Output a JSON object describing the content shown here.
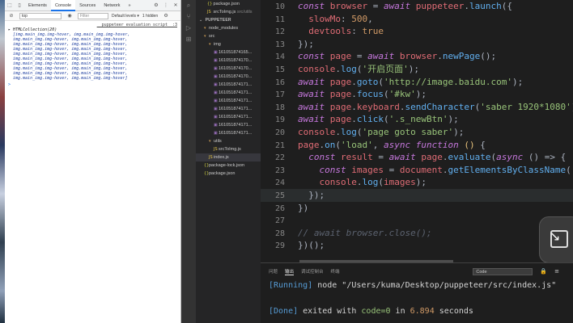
{
  "devtools": {
    "tabs": [
      "Elements",
      "Console",
      "Sources",
      "Network",
      "»"
    ],
    "active_tab": "Console",
    "context": "top",
    "filter_placeholder": "Filter",
    "levels": "Default levels ▾",
    "hidden_count": "1 hidden",
    "source_link": "__puppeteer_evaluation_script__:3",
    "collection_label": "HTMLCollection(20)",
    "collection_items": [
      "[img.main_img.img-hover, img.main_img.img-hover,",
      "img.main_img.img-hover, img.main_img.img-hover,",
      "img.main_img.img-hover, img.main_img.img-hover,",
      "img.main_img.img-hover, img.main_img.img-hover,",
      "img.main_img.img-hover, img.main_img.img-hover,",
      "img.main_img.img-hover, img.main_img.img-hover,",
      "img.main_img.img-hover, img.main_img.img-hover,",
      "img.main_img.img-hover, img.main_img.img-hover,",
      "img.main_img.img-hover, img.main_img.img-hover,",
      "img.main_img.img-hover, img.main_img.img-hover]"
    ],
    "prompt": ">"
  },
  "explorer": {
    "top_items": [
      {
        "name": "package.json",
        "icon": "json"
      },
      {
        "name": "srcToImg.js",
        "icon": "js",
        "suffix": "src/utils"
      }
    ],
    "section_title": "PUPPETEER",
    "tree": [
      {
        "name": "node_modules",
        "type": "folder",
        "depth": 1
      },
      {
        "name": "src",
        "type": "folder",
        "depth": 1
      },
      {
        "name": "img",
        "type": "folder",
        "depth": 2
      },
      {
        "name": "161051874165...",
        "type": "image",
        "depth": 3
      },
      {
        "name": "161051874170...",
        "type": "image",
        "depth": 3
      },
      {
        "name": "161051874170...",
        "type": "image",
        "depth": 3
      },
      {
        "name": "161051874170...",
        "type": "image",
        "depth": 3
      },
      {
        "name": "161051874171...",
        "type": "image",
        "depth": 3
      },
      {
        "name": "161051874171...",
        "type": "image",
        "depth": 3
      },
      {
        "name": "161051874171...",
        "type": "image",
        "depth": 3
      },
      {
        "name": "161051874171...",
        "type": "image",
        "depth": 3
      },
      {
        "name": "161051874171...",
        "type": "image",
        "depth": 3
      },
      {
        "name": "161051874171...",
        "type": "image",
        "depth": 3
      },
      {
        "name": "161051874171...",
        "type": "image",
        "depth": 3
      },
      {
        "name": "utils",
        "type": "folder",
        "depth": 2
      },
      {
        "name": "srcToImg.js",
        "type": "js",
        "depth": 3
      },
      {
        "name": "index.js",
        "type": "js",
        "depth": 2,
        "selected": true
      },
      {
        "name": "package-lock.json",
        "type": "json",
        "depth": 1
      },
      {
        "name": "package.json",
        "type": "json",
        "depth": 1
      }
    ]
  },
  "editor": {
    "lines": [
      {
        "n": "10",
        "tokens": [
          [
            "kw",
            "const "
          ],
          [
            "var",
            "browser"
          ],
          [
            "pun",
            " = "
          ],
          [
            "kw",
            "await "
          ],
          [
            "var",
            "puppeteer"
          ],
          [
            "pun",
            "."
          ],
          [
            "fn",
            "launch"
          ],
          [
            "pun",
            "({"
          ]
        ]
      },
      {
        "n": "11",
        "tokens": [
          [
            "prop",
            "  slowMo"
          ],
          [
            "pun",
            ": "
          ],
          [
            "num",
            "500"
          ],
          [
            "pun",
            ","
          ]
        ]
      },
      {
        "n": "12",
        "tokens": [
          [
            "prop",
            "  devtools"
          ],
          [
            "pun",
            ": "
          ],
          [
            "num",
            "true"
          ]
        ]
      },
      {
        "n": "13",
        "tokens": [
          [
            "pun",
            "});"
          ]
        ]
      },
      {
        "n": "14",
        "tokens": [
          [
            "kw",
            "const "
          ],
          [
            "var",
            "page"
          ],
          [
            "pun",
            " = "
          ],
          [
            "kw",
            "await "
          ],
          [
            "var",
            "browser"
          ],
          [
            "pun",
            "."
          ],
          [
            "fn",
            "newPage"
          ],
          [
            "pun",
            "();"
          ]
        ]
      },
      {
        "n": "15",
        "tokens": [
          [
            "var",
            "console"
          ],
          [
            "pun",
            "."
          ],
          [
            "fn",
            "log"
          ],
          [
            "pun",
            "("
          ],
          [
            "str",
            "'开启页面'"
          ],
          [
            "pun",
            ");"
          ]
        ]
      },
      {
        "n": "16",
        "tokens": [
          [
            "kw",
            "await "
          ],
          [
            "var",
            "page"
          ],
          [
            "pun",
            "."
          ],
          [
            "fn",
            "goto"
          ],
          [
            "pun",
            "("
          ],
          [
            "str",
            "'http://image.baidu.com'"
          ],
          [
            "pun",
            ");"
          ]
        ]
      },
      {
        "n": "17",
        "tokens": [
          [
            "kw",
            "await "
          ],
          [
            "var",
            "page"
          ],
          [
            "pun",
            "."
          ],
          [
            "fn",
            "focus"
          ],
          [
            "pun",
            "("
          ],
          [
            "str",
            "'#kw'"
          ],
          [
            "pun",
            ");"
          ]
        ]
      },
      {
        "n": "18",
        "tokens": [
          [
            "kw",
            "await "
          ],
          [
            "var",
            "page"
          ],
          [
            "pun",
            "."
          ],
          [
            "var",
            "keyboard"
          ],
          [
            "pun",
            "."
          ],
          [
            "fn",
            "sendCharacter"
          ],
          [
            "pun",
            "("
          ],
          [
            "str",
            "'saber 1920*1080'"
          ],
          [
            "pun",
            ");"
          ]
        ]
      },
      {
        "n": "19",
        "tokens": [
          [
            "kw",
            "await "
          ],
          [
            "var",
            "page"
          ],
          [
            "pun",
            "."
          ],
          [
            "fn",
            "click"
          ],
          [
            "pun",
            "("
          ],
          [
            "str",
            "'.s_newBtn'"
          ],
          [
            "pun",
            ");"
          ]
        ]
      },
      {
        "n": "20",
        "tokens": [
          [
            "var",
            "console"
          ],
          [
            "pun",
            "."
          ],
          [
            "fn",
            "log"
          ],
          [
            "pun",
            "("
          ],
          [
            "str",
            "'page goto saber'"
          ],
          [
            "pun",
            ");"
          ]
        ]
      },
      {
        "n": "21",
        "tokens": [
          [
            "var",
            "page"
          ],
          [
            "pun",
            "."
          ],
          [
            "fn",
            "on"
          ],
          [
            "pun",
            "("
          ],
          [
            "str",
            "'load'"
          ],
          [
            "pun",
            ", "
          ],
          [
            "kw",
            "async "
          ],
          [
            "kw",
            "function "
          ],
          [
            "cls",
            "()"
          ],
          [
            "pun",
            " {"
          ]
        ]
      },
      {
        "n": "22",
        "tokens": [
          [
            "kw",
            "  const "
          ],
          [
            "var",
            "result"
          ],
          [
            "pun",
            " = "
          ],
          [
            "kw",
            "await "
          ],
          [
            "var",
            "page"
          ],
          [
            "pun",
            "."
          ],
          [
            "fn",
            "evaluate"
          ],
          [
            "pun",
            "("
          ],
          [
            "kw",
            "async "
          ],
          [
            "pun",
            "() => {"
          ]
        ]
      },
      {
        "n": "23",
        "tokens": [
          [
            "kw",
            "    const "
          ],
          [
            "var",
            "images"
          ],
          [
            "pun",
            " = "
          ],
          [
            "var",
            "document"
          ],
          [
            "pun",
            "."
          ],
          [
            "fn",
            "getElementsByClassName"
          ],
          [
            "pun",
            "("
          ],
          [
            "str",
            "'main_i"
          ]
        ]
      },
      {
        "n": "24",
        "tokens": [
          [
            "var",
            "    console"
          ],
          [
            "pun",
            "."
          ],
          [
            "fn",
            "log"
          ],
          [
            "pun",
            "("
          ],
          [
            "var",
            "images"
          ],
          [
            "pun",
            ");"
          ]
        ]
      },
      {
        "n": "25",
        "tokens": [
          [
            "pun",
            "  });"
          ]
        ],
        "current": true
      },
      {
        "n": "26",
        "tokens": [
          [
            "pun",
            "})"
          ]
        ]
      },
      {
        "n": "27",
        "tokens": []
      },
      {
        "n": "28",
        "tokens": [
          [
            "cmt",
            "// await browser.close();"
          ]
        ]
      },
      {
        "n": "29",
        "tokens": [
          [
            "pun",
            "})();"
          ]
        ]
      }
    ]
  },
  "panel": {
    "tabs": [
      "问题",
      "输出",
      "调试控制台",
      "终端"
    ],
    "active_tab": "输出",
    "channel": "Code",
    "output": {
      "running_tag": "[Running]",
      "running_cmd": " node \"/Users/kuma/Desktop/puppeteer/src/index.js\"",
      "done_tag": "[Done]",
      "done_pre": " exited with ",
      "done_code": "code=0",
      "done_in": " in ",
      "done_time": "6.894",
      "done_unit": " seconds"
    }
  },
  "colors": {
    "editor_bg": "#1e1e1e",
    "keyword": "#c678dd",
    "string": "#98c379",
    "function": "#61afef",
    "variable": "#e06c75"
  }
}
